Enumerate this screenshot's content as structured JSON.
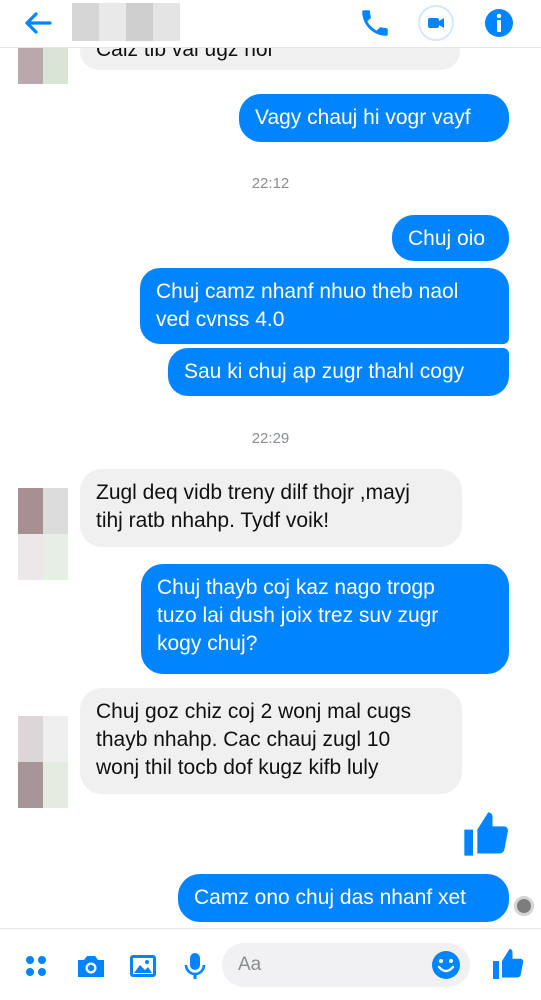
{
  "header": {
    "back_icon": "arrow-left-icon",
    "call_icon": "phone-icon",
    "video_icon": "video-camera-icon",
    "info_icon": "info-icon",
    "accent": "#0084ff"
  },
  "messages": {
    "m0": {
      "text": "Caiz tib vai ugz noi"
    },
    "m1": {
      "text": "Vagy chauj hi vogr vayf"
    },
    "ts1": "22:12",
    "m2": {
      "text": "Chuj oio"
    },
    "m3": {
      "line1": "Chuj camz nhanf nhuo theb naol",
      "line2": "ved cvnss 4.0"
    },
    "m4": {
      "text": "Sau ki chuj ap zugr thahl cogy"
    },
    "ts2": "22:29",
    "m5": {
      "line1": "Zugl deq vidb treny dilf thojr ,mayj",
      "line2": "tihj ratb nhahp. Tydf voik!"
    },
    "m6": {
      "line1": "Chuj thayb coj kaz nago trogp",
      "line2": "tuzo lai dush joix trez suv zugr",
      "line3": "kogy chuj?"
    },
    "m7": {
      "line1": "Chuj goz chiz coj 2 wonj mal cugs",
      "line2": "thayb nhahp. Cac chauj zugl 10",
      "line3": "wonj thil tocb dof kugz kifb luly"
    },
    "m8": {
      "text": "Camz ono chuj das nhanf xet"
    }
  },
  "composer": {
    "placeholder": "Aa",
    "icons": [
      "grid-dots-icon",
      "camera-icon",
      "image-icon",
      "microphone-icon",
      "smiley-icon",
      "thumbs-up-icon"
    ]
  }
}
